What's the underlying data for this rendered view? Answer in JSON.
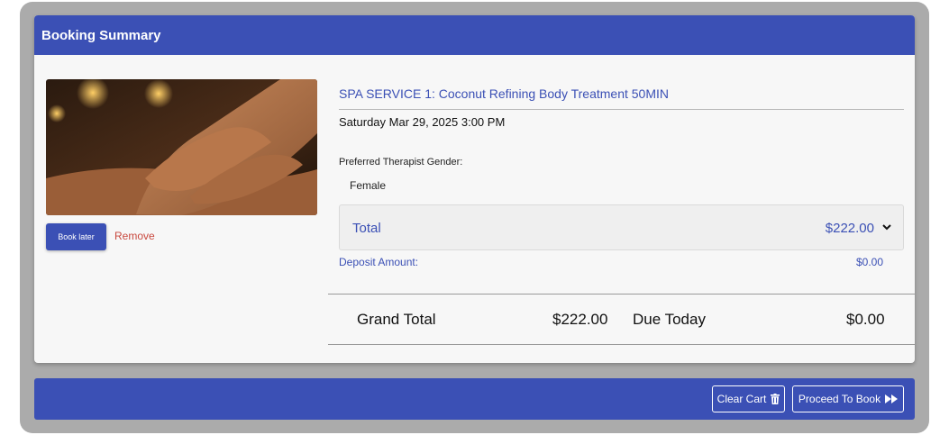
{
  "header": {
    "title": "Booking Summary"
  },
  "item": {
    "image": "massage-photo",
    "book_later_label": "Book later",
    "remove_label": "Remove",
    "service_title": "SPA SERVICE 1: Coconut Refining Body Treatment 50MIN",
    "datetime": "Saturday Mar 29, 2025 3:00 PM",
    "preference_label": "Preferred Therapist Gender:",
    "preference_value": "Female",
    "total_label": "Total",
    "total_value": "$222.00",
    "deposit_label": "Deposit Amount:",
    "deposit_value": "$0.00"
  },
  "summary": {
    "grand_total_label": "Grand Total",
    "grand_total_value": "$222.00",
    "due_today_label": "Due Today",
    "due_today_value": "$0.00"
  },
  "footer": {
    "clear_cart_label": "Clear Cart",
    "clear_cart_icon": "trash-icon",
    "proceed_label": "Proceed To Book",
    "proceed_icon": "fast-forward-icon"
  },
  "colors": {
    "primary": "#3b50b5",
    "remove": "#c9493f",
    "frame": "#ababab",
    "panel": "#f7f7f7"
  }
}
